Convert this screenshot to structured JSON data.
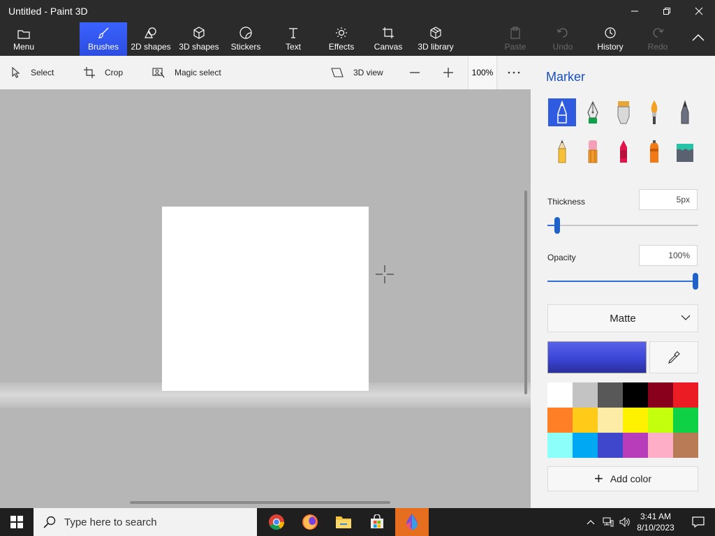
{
  "window": {
    "title": "Untitled - Paint 3D"
  },
  "ribbon": {
    "menu": "Menu",
    "brushes": "Brushes",
    "shapes_2d": "2D shapes",
    "shapes_3d": "3D shapes",
    "stickers": "Stickers",
    "text": "Text",
    "effects": "Effects",
    "canvas": "Canvas",
    "library_3d": "3D library",
    "paste": "Paste",
    "undo": "Undo",
    "history": "History",
    "redo": "Redo"
  },
  "toolbar": {
    "select": "Select",
    "crop": "Crop",
    "magic_select": "Magic select",
    "view_3d": "3D view",
    "zoom": "100%"
  },
  "panel": {
    "title": "Marker",
    "brushes": [
      "marker",
      "calligraphy-pen",
      "oil-brush",
      "watercolor",
      "pixel-pen",
      "pencil",
      "eraser",
      "crayon",
      "spray-can",
      "fill"
    ],
    "thickness_label": "Thickness",
    "thickness_value": "5px",
    "thickness_fraction": 0.05,
    "opacity_label": "Opacity",
    "opacity_value": "100%",
    "opacity_fraction": 1.0,
    "finish": "Matte",
    "current_color": "#3b45d6",
    "palette": [
      "#ffffff",
      "#c3c3c3",
      "#585858",
      "#000000",
      "#88001b",
      "#ec1c24",
      "#ff7f27",
      "#ffca18",
      "#fdeca6",
      "#fff200",
      "#c4ff0e",
      "#0ed145",
      "#8cfffb",
      "#00a8f3",
      "#3f48cc",
      "#b83dba",
      "#ffaec8",
      "#b97a56"
    ],
    "add_color": "Add color"
  },
  "taskbar": {
    "search_placeholder": "Type here to search",
    "time": "3:41 AM",
    "date": "8/10/2023"
  }
}
